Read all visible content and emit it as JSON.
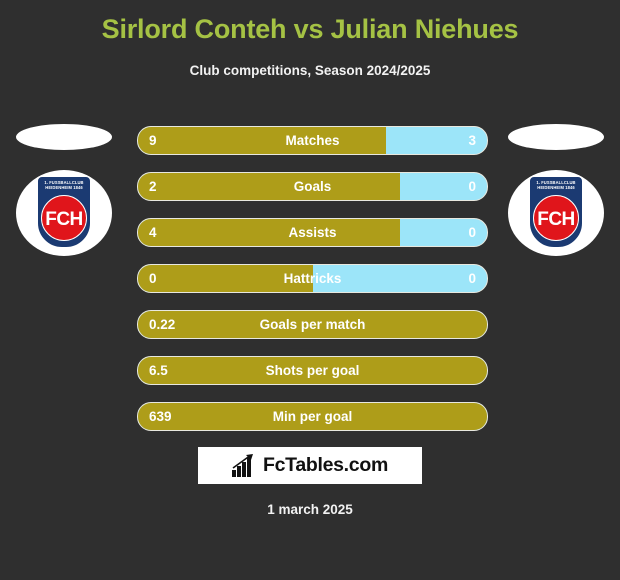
{
  "header": {
    "title": "Sirlord Conteh vs Julian Niehues",
    "subtitle": "Club competitions, Season 2024/2025",
    "title_color": "#a5c244"
  },
  "colors": {
    "background": "#2f2f2f",
    "home_bar": "#ae9d19",
    "away_bar": "#9ce5f9",
    "text": "#ffffff"
  },
  "badges": {
    "left": {
      "club_name_line1": "1. FUSSBALLCLUB",
      "club_name_line2": "HEIDENHEIM 1846",
      "initials": "FCH",
      "shield_color": "#1b3a72",
      "circle_color": "#e0151b"
    },
    "right": {
      "club_name_line1": "1. FUSSBALLCLUB",
      "club_name_line2": "HEIDENHEIM 1846",
      "initials": "FCH",
      "shield_color": "#1b3a72",
      "circle_color": "#e0151b"
    }
  },
  "stats": [
    {
      "label": "Matches",
      "left": "9",
      "right": "3",
      "fill_pct": 71
    },
    {
      "label": "Goals",
      "left": "2",
      "right": "0",
      "fill_pct": 75
    },
    {
      "label": "Assists",
      "left": "4",
      "right": "0",
      "fill_pct": 75
    },
    {
      "label": "Hattricks",
      "left": "0",
      "right": "0",
      "fill_pct": 50
    },
    {
      "label": "Goals per match",
      "left": "0.22",
      "right": "",
      "fill_pct": 100
    },
    {
      "label": "Shots per goal",
      "left": "6.5",
      "right": "",
      "fill_pct": 100
    },
    {
      "label": "Min per goal",
      "left": "639",
      "right": "",
      "fill_pct": 100
    }
  ],
  "footer": {
    "brand": "FcTables.com",
    "brand_icon": "bar-chart-arrow-icon",
    "date": "1 march 2025"
  }
}
